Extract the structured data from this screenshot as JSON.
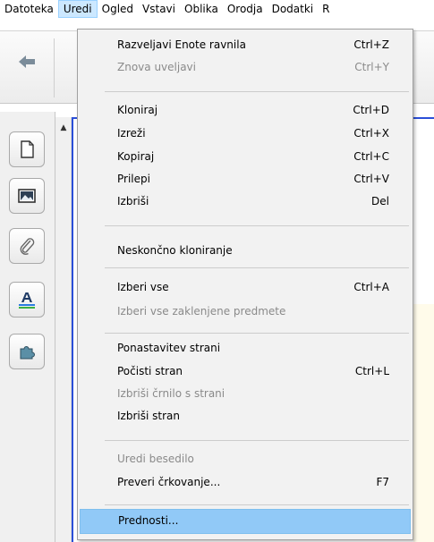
{
  "menubar": {
    "items": [
      "Datoteka",
      "Uredi",
      "Ogled",
      "Vstavi",
      "Oblika",
      "Orodja",
      "Dodatki",
      "R"
    ]
  },
  "toolbar": {
    "back_icon": "arrow-left-icon"
  },
  "sidebar": {
    "tabs": [
      {
        "icon": "page-icon"
      },
      {
        "icon": "image-icon"
      },
      {
        "icon": "paperclip-icon"
      },
      {
        "icon": "text-format-icon"
      },
      {
        "icon": "puzzle-icon"
      }
    ]
  },
  "edit_menu": {
    "items": [
      {
        "label": "Razveljavi Enote ravnila",
        "shortcut": "Ctrl+Z",
        "disabled": false
      },
      {
        "label": "Znova uveljavi",
        "shortcut": "Ctrl+Y",
        "disabled": true
      },
      {
        "label": "Kloniraj",
        "shortcut": "Ctrl+D",
        "disabled": false
      },
      {
        "label": "Izreži",
        "shortcut": "Ctrl+X",
        "disabled": false
      },
      {
        "label": "Kopiraj",
        "shortcut": "Ctrl+C",
        "disabled": false
      },
      {
        "label": "Prilepi",
        "shortcut": "Ctrl+V",
        "disabled": false
      },
      {
        "label": "Izbriši",
        "shortcut": "Del",
        "disabled": false
      },
      {
        "label": "Neskončno kloniranje",
        "shortcut": "",
        "disabled": false
      },
      {
        "label": "Izberi vse",
        "shortcut": "Ctrl+A",
        "disabled": false
      },
      {
        "label": "Izberi vse zaklenjene predmete",
        "shortcut": "",
        "disabled": true
      },
      {
        "label": "Ponastavitev strani",
        "shortcut": "",
        "disabled": false
      },
      {
        "label": "Počisti stran",
        "shortcut": "Ctrl+L",
        "disabled": false
      },
      {
        "label": "Izbriši črnilo s strani",
        "shortcut": "",
        "disabled": true
      },
      {
        "label": "Izbriši stran",
        "shortcut": "",
        "disabled": false
      },
      {
        "label": "Uredi besedilo",
        "shortcut": "",
        "disabled": true
      },
      {
        "label": "Preveri črkovanje...",
        "shortcut": "F7",
        "disabled": false
      },
      {
        "label": "Prednosti...",
        "shortcut": "",
        "disabled": false,
        "highlighted": true
      }
    ]
  },
  "colors": {
    "highlight": "#91c9f7",
    "disabled_text": "#8a8a8a",
    "canvas_border": "#2b4fd8"
  }
}
